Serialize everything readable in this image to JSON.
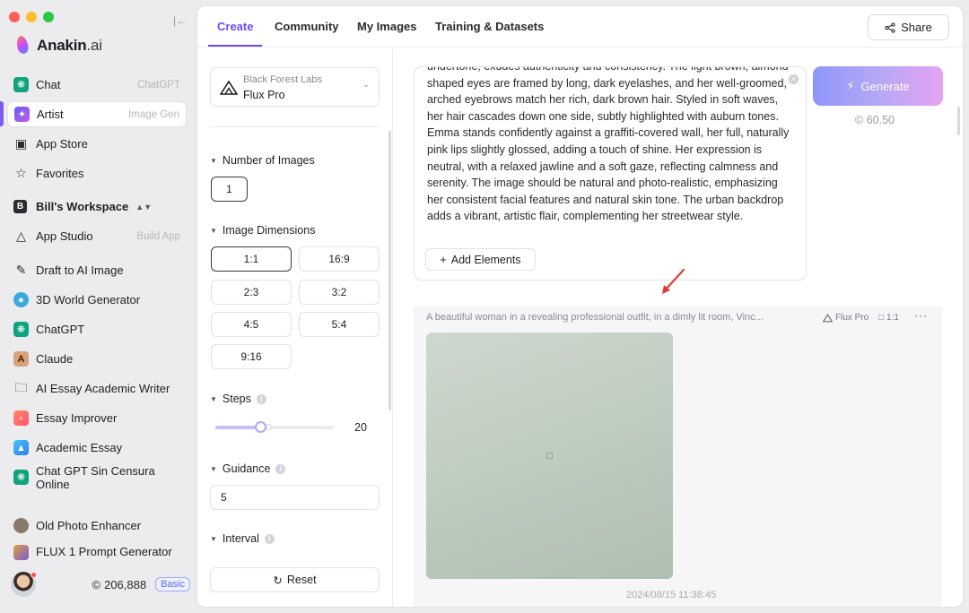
{
  "brand": {
    "name": "Anakin",
    "suffix": ".ai"
  },
  "sidebar": {
    "primary": [
      {
        "label": "Chat",
        "hint": "ChatGPT",
        "icon": "chatgpt-icon",
        "color": "#10a37f"
      },
      {
        "label": "Artist",
        "hint": "Image Gen",
        "icon": "artist-icon",
        "color": "#6c5cf0",
        "active": true
      },
      {
        "label": "App Store",
        "hint": "",
        "icon": "app-store-icon"
      },
      {
        "label": "Favorites",
        "hint": "",
        "icon": "star-icon"
      }
    ],
    "workspace": {
      "badge": "B",
      "label": "Bill's Workspace"
    },
    "studio": {
      "label": "App Studio",
      "hint": "Build App"
    },
    "apps": [
      {
        "label": "Draft to AI Image",
        "icon": "draft-icon"
      },
      {
        "label": "3D World Generator",
        "icon": "globe-icon"
      },
      {
        "label": "ChatGPT",
        "icon": "chatgpt-icon"
      },
      {
        "label": "Claude",
        "icon": "claude-icon"
      },
      {
        "label": "AI Essay Academic Writer",
        "icon": "folder-icon"
      },
      {
        "label": "Essay Improver",
        "icon": "essay-improver-icon"
      },
      {
        "label": "Academic Essay",
        "icon": "academic-icon"
      },
      {
        "label": "Chat GPT Sin Censura Online",
        "icon": "chatgpt-icon"
      },
      {
        "label": "Old Photo Enhancer",
        "icon": "photo-icon"
      },
      {
        "label": "FLUX 1 Prompt Generator",
        "icon": "flux-icon"
      }
    ],
    "credits": "206,888",
    "plan": "Basic"
  },
  "tabs": [
    "Create",
    "Community",
    "My Images",
    "Training & Datasets"
  ],
  "share_label": "Share",
  "model": {
    "company": "Black Forest Labs",
    "name": "Flux Pro"
  },
  "settings": {
    "num_images_label": "Number of Images",
    "num_images_value": "1",
    "dimensions_label": "Image Dimensions",
    "ratios": [
      "1:1",
      "16:9",
      "2:3",
      "3:2",
      "4:5",
      "5:4",
      "9:16"
    ],
    "selected_ratio": "1:1",
    "steps_label": "Steps",
    "steps_value": "20",
    "guidance_label": "Guidance",
    "guidance_value": "5",
    "interval_label": "Interval",
    "reset_label": "Reset"
  },
  "prompt": {
    "text": "undertone, exudes authenticity and consistency. The light brown, almond-shaped eyes are framed by long, dark eyelashes, and her well-groomed, arched eyebrows match her rich, dark brown hair. Styled in soft waves, her hair cascades down one side, subtly highlighted with auburn tones. Emma stands confidently against a graffiti-covered wall, her full, naturally pink lips slightly glossed, adding a touch of shine. Her expression is neutral, with a relaxed jawline and a soft gaze, reflecting calmness and serenity. The image should be natural and photo-realistic, emphasizing her consistent facial features and natural skin tone. The urban backdrop adds a vibrant, artistic flair, complementing her streetwear style.",
    "add_elements_label": "Add Elements"
  },
  "generate": {
    "label": "Generate",
    "cost": "60.50"
  },
  "result": {
    "prompt": "A beautiful woman in a revealing professional outfit, in a dimly lit room, Vinc...",
    "model": "Flux Pro",
    "ratio": "1:1",
    "timestamp": "2024/08/15 11:38:45"
  }
}
